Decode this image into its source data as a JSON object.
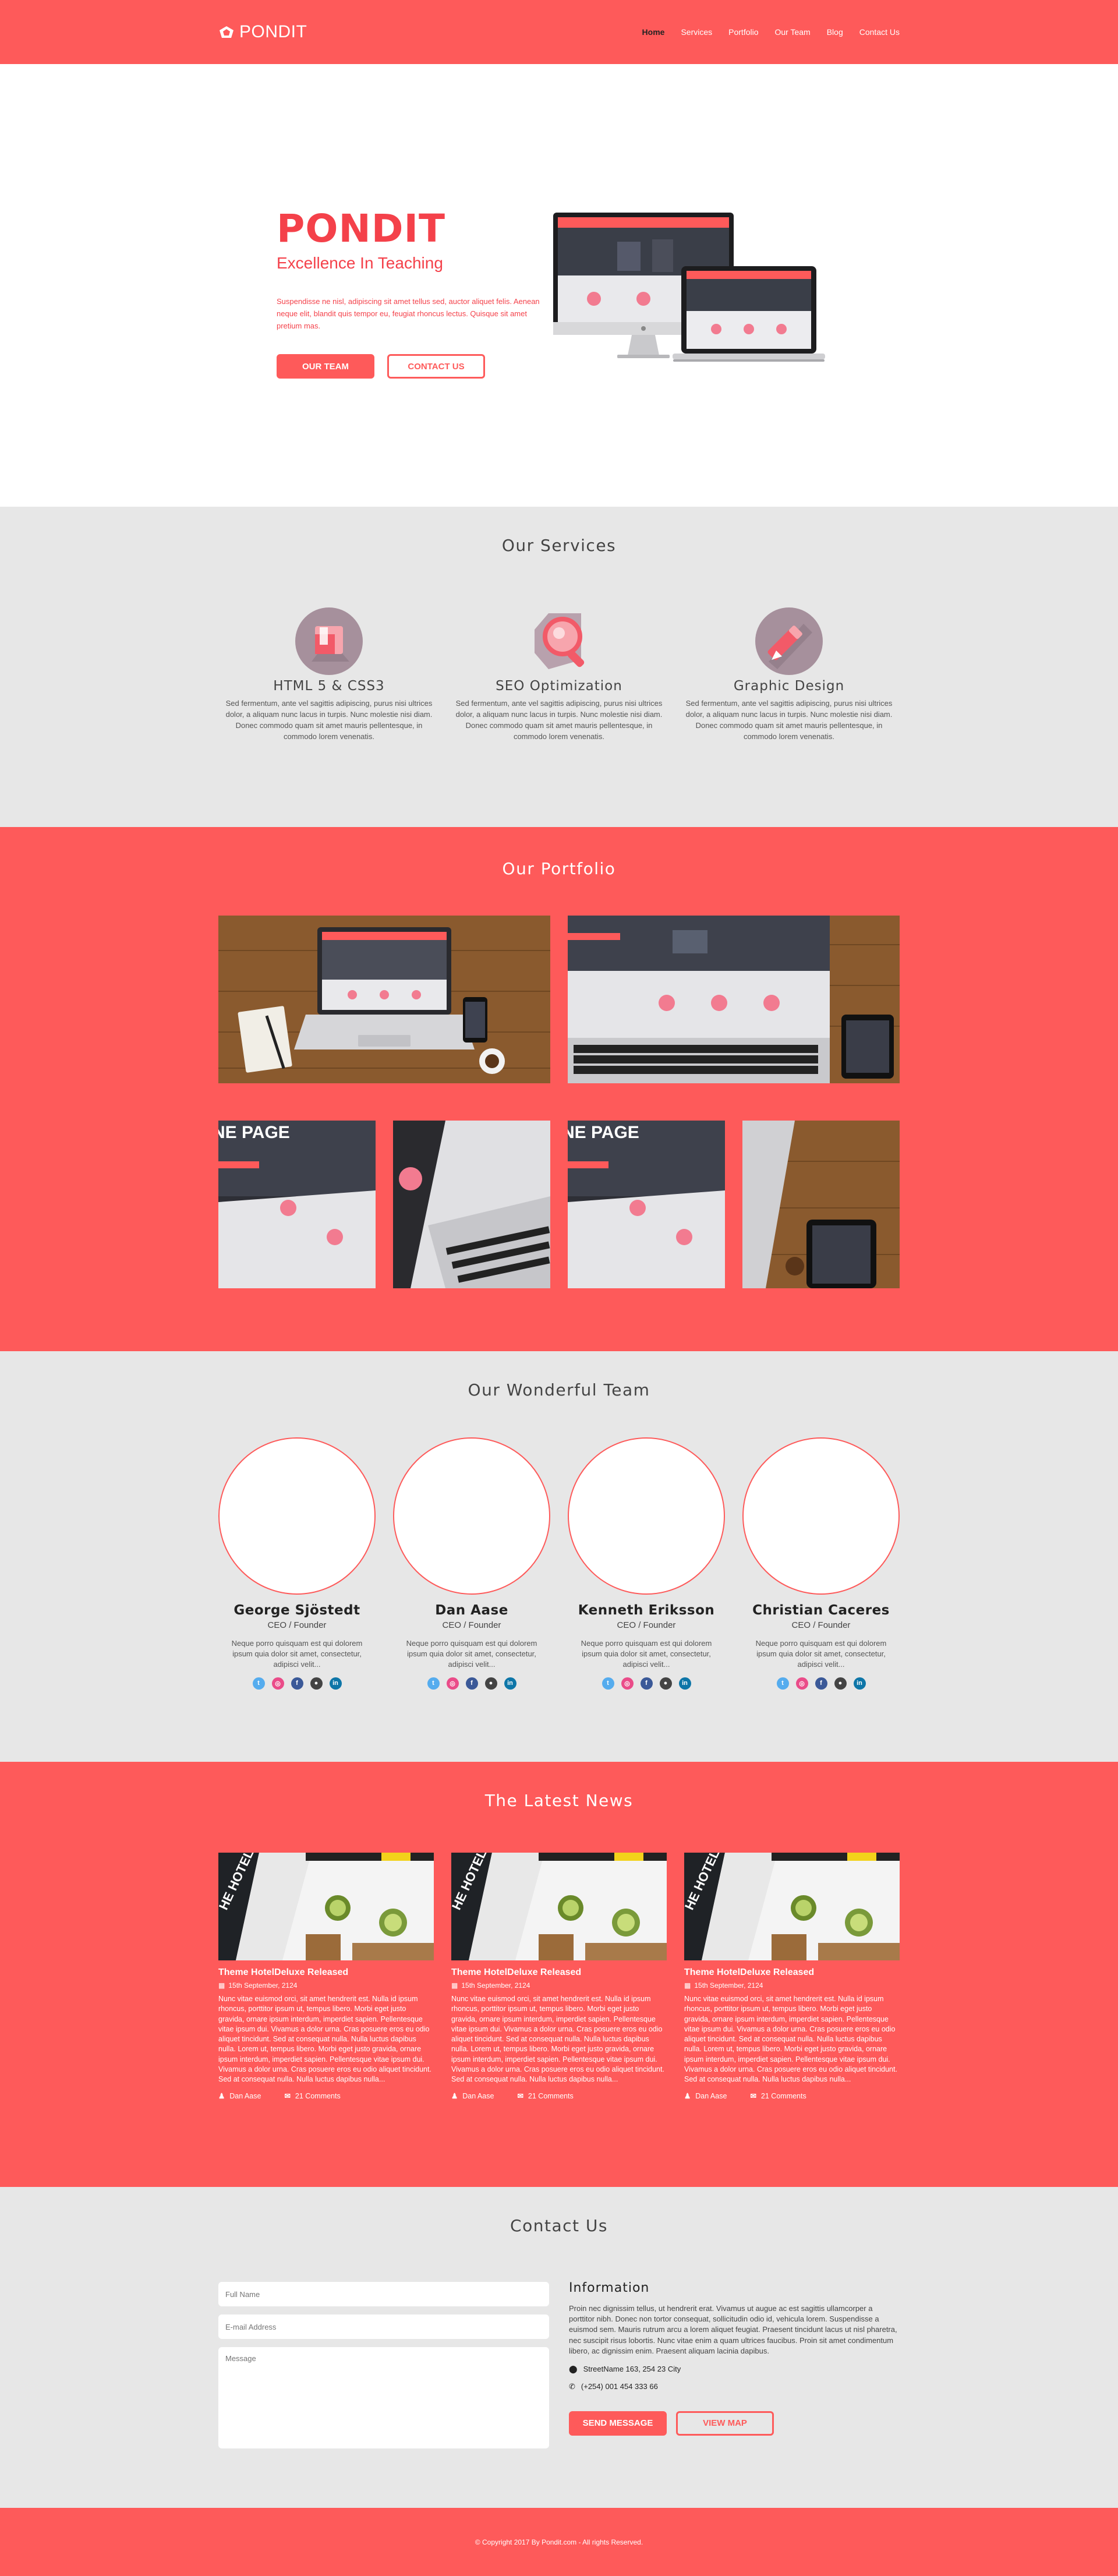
{
  "brand": {
    "name": "PONDIT"
  },
  "nav": {
    "items": [
      "Home",
      "Services",
      "Portfolio",
      "Our Team",
      "Blog",
      "Contact Us"
    ]
  },
  "hero": {
    "title": "PONDIT",
    "subtitle": "Excellence In Teaching",
    "description": "Suspendisse ne nisl, adipiscing sit amet tellus sed, auctor aliquet felis. Aenean neque elit, blandit quis tempor eu, feugiat rhoncus lectus. Quisque sit amet pretium mas.",
    "btn_team": "OUR TEAM",
    "btn_contact": "CONTACT US"
  },
  "services": {
    "title": "Our Services",
    "items": [
      {
        "name": "HTML 5 & CSS3",
        "icon": "html-css-icon",
        "desc": "Sed fermentum, ante vel sagittis adipiscing, purus nisi ultrices dolor, a aliquam nunc lacus in turpis. Nunc molestie nisi diam. Donec commodo quam sit amet mauris pellentesque, in commodo lorem venenatis."
      },
      {
        "name": "SEO Optimization",
        "icon": "magnifier-icon",
        "desc": "Sed fermentum, ante vel sagittis adipiscing, purus nisi ultrices dolor, a aliquam nunc lacus in turpis. Nunc molestie nisi diam. Donec commodo quam sit amet mauris pellentesque, in commodo lorem venenatis."
      },
      {
        "name": "Graphic Design",
        "icon": "pencil-icon",
        "desc": "Sed fermentum, ante vel sagittis adipiscing, purus nisi ultrices dolor, a aliquam nunc lacus in turpis. Nunc molestie nisi diam. Donec commodo quam sit amet mauris pellentesque, in commodo lorem venenatis."
      }
    ]
  },
  "portfolio": {
    "title": "Our Portfolio"
  },
  "team": {
    "title": "Our Wonderful Team",
    "members": [
      {
        "name": "George Sjöstedt",
        "role": "CEO / Founder",
        "bio": "Neque porro quisquam est qui dolorem ipsum quia dolor sit amet, consectetur, adipisci velit..."
      },
      {
        "name": "Dan Aase",
        "role": "CEO / Founder",
        "bio": "Neque porro quisquam est qui dolorem ipsum quia dolor sit amet, consectetur, adipisci velit..."
      },
      {
        "name": "Kenneth Eriksson",
        "role": "CEO / Founder",
        "bio": "Neque porro quisquam est qui dolorem ipsum quia dolor sit amet, consectetur, adipisci velit..."
      },
      {
        "name": "Christian Caceres",
        "role": "CEO / Founder",
        "bio": "Neque porro quisquam est qui dolorem ipsum quia dolor sit amet, consectetur, adipisci velit..."
      }
    ],
    "socials": [
      {
        "icon": "twitter-icon",
        "glyph": "t",
        "color": "#55acee"
      },
      {
        "icon": "dribbble-icon",
        "glyph": "◎",
        "color": "#ea4c89"
      },
      {
        "icon": "facebook-icon",
        "glyph": "f",
        "color": "#3b5998"
      },
      {
        "icon": "github-icon",
        "glyph": "●",
        "color": "#444444"
      },
      {
        "icon": "linkedin-icon",
        "glyph": "in",
        "color": "#0e76a8"
      }
    ]
  },
  "news": {
    "title": "The Latest News",
    "posts": [
      {
        "title": "Theme HotelDeluxe Released",
        "date": "15th September, 2124",
        "body": "Nunc vitae euismod orci, sit amet hendrerit est. Nulla id ipsum rhoncus, porttitor ipsum ut, tempus libero. Morbi eget justo gravida, ornare ipsum interdum, imperdiet sapien. Pellentesque vitae ipsum dui. Vivamus a dolor urna. Cras posuere eros eu odio aliquet tincidunt. Sed at consequat nulla. Nulla luctus dapibus nulla. Lorem ut, tempus libero. Morbi eget justo gravida, ornare ipsum interdum, imperdiet sapien. Pellentesque vitae ipsum dui. Vivamus a dolor urna. Cras posuere eros eu odio aliquet tincidunt. Sed at consequat nulla. Nulla luctus dapibus nulla...",
        "author": "Dan Aase",
        "comments": "21 Comments"
      },
      {
        "title": "Theme HotelDeluxe Released",
        "date": "15th September, 2124",
        "body": "Nunc vitae euismod orci, sit amet hendrerit est. Nulla id ipsum rhoncus, porttitor ipsum ut, tempus libero. Morbi eget justo gravida, ornare ipsum interdum, imperdiet sapien. Pellentesque vitae ipsum dui. Vivamus a dolor urna. Cras posuere eros eu odio aliquet tincidunt. Sed at consequat nulla. Nulla luctus dapibus nulla. Lorem ut, tempus libero. Morbi eget justo gravida, ornare ipsum interdum, imperdiet sapien. Pellentesque vitae ipsum dui. Vivamus a dolor urna. Cras posuere eros eu odio aliquet tincidunt. Sed at consequat nulla. Nulla luctus dapibus nulla...",
        "author": "Dan Aase",
        "comments": "21 Comments"
      },
      {
        "title": "Theme HotelDeluxe Released",
        "date": "15th September, 2124",
        "body": "Nunc vitae euismod orci, sit amet hendrerit est. Nulla id ipsum rhoncus, porttitor ipsum ut, tempus libero. Morbi eget justo gravida, ornare ipsum interdum, imperdiet sapien. Pellentesque vitae ipsum dui. Vivamus a dolor urna. Cras posuere eros eu odio aliquet tincidunt. Sed at consequat nulla. Nulla luctus dapibus nulla. Lorem ut, tempus libero. Morbi eget justo gravida, ornare ipsum interdum, imperdiet sapien. Pellentesque vitae ipsum dui. Vivamus a dolor urna. Cras posuere eros eu odio aliquet tincidunt. Sed at consequat nulla. Nulla luctus dapibus nulla...",
        "author": "Dan Aase",
        "comments": "21 Comments"
      }
    ]
  },
  "contact": {
    "title": "Contact Us",
    "placeholders": {
      "name": "Full Name",
      "email": "E-mail Address",
      "message": "Message"
    },
    "info_title": "Information",
    "info_text": "Proin nec dignissim tellus, ut hendrerit erat. Vivamus ut augue ac est sagittis ullamcorper a porttitor nibh. Donec non tortor consequat, sollicitudin odio id, vehicula lorem. Suspendisse a euismod sem. Mauris rutrum arcu a lorem aliquet feugiat. Praesent tincidunt lacus ut nisl pharetra, nec suscipit risus lobortis. Nunc vitae enim a quam ultrices faucibus. Proin sit amet condimentum libero, ac dignissim enim. Praesent aliquam lacinia dapibus.",
    "address": "StreetName 163, 254 23 City",
    "phone": "(+254) 001 454 333 66",
    "btn_send": "SEND MESSAGE",
    "btn_map": "VIEW MAP"
  },
  "footer": {
    "text": "© Copyright 2017 By Pondit.com - All rights Reserved."
  },
  "colors": {
    "accent": "#fe5a5a",
    "hero_text": "#f4414a",
    "section_gray": "#e7e7e7"
  }
}
